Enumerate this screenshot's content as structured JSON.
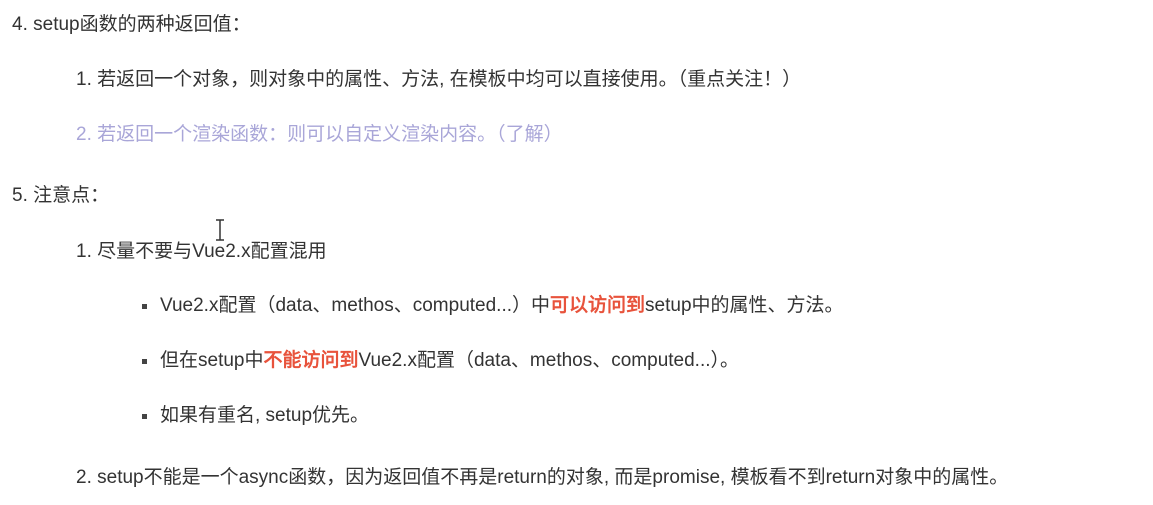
{
  "section4": {
    "heading": "4. setup函数的两种返回值：",
    "items": [
      "1. 若返回一个对象，则对象中的属性、方法, 在模板中均可以直接使用。（重点关注！）",
      "2. 若返回一个渲染函数：则可以自定义渲染内容。（了解）"
    ]
  },
  "section5": {
    "heading": "5. 注意点：",
    "item1": {
      "text": "1. 尽量不要与Vue2.x配置混用",
      "bullets": [
        {
          "pre": "Vue2.x配置（data、methos、computed...）中",
          "highlight": "可以访问到",
          "post": "setup中的属性、方法。"
        },
        {
          "pre": "但在setup中",
          "highlight": "不能访问到",
          "post": "Vue2.x配置（data、methos、computed...）。"
        },
        {
          "pre": "如果有重名, setup优先。",
          "highlight": "",
          "post": ""
        }
      ]
    },
    "item2": {
      "text": "2. setup不能是一个async函数，因为返回值不再是return的对象, 而是promise, 模板看不到return对象中的属性。"
    }
  },
  "colors": {
    "text": "#333333",
    "muted": "#a9a6d8",
    "highlight": "#e8533c"
  },
  "icons": {
    "cursor": "text-cursor-icon"
  }
}
